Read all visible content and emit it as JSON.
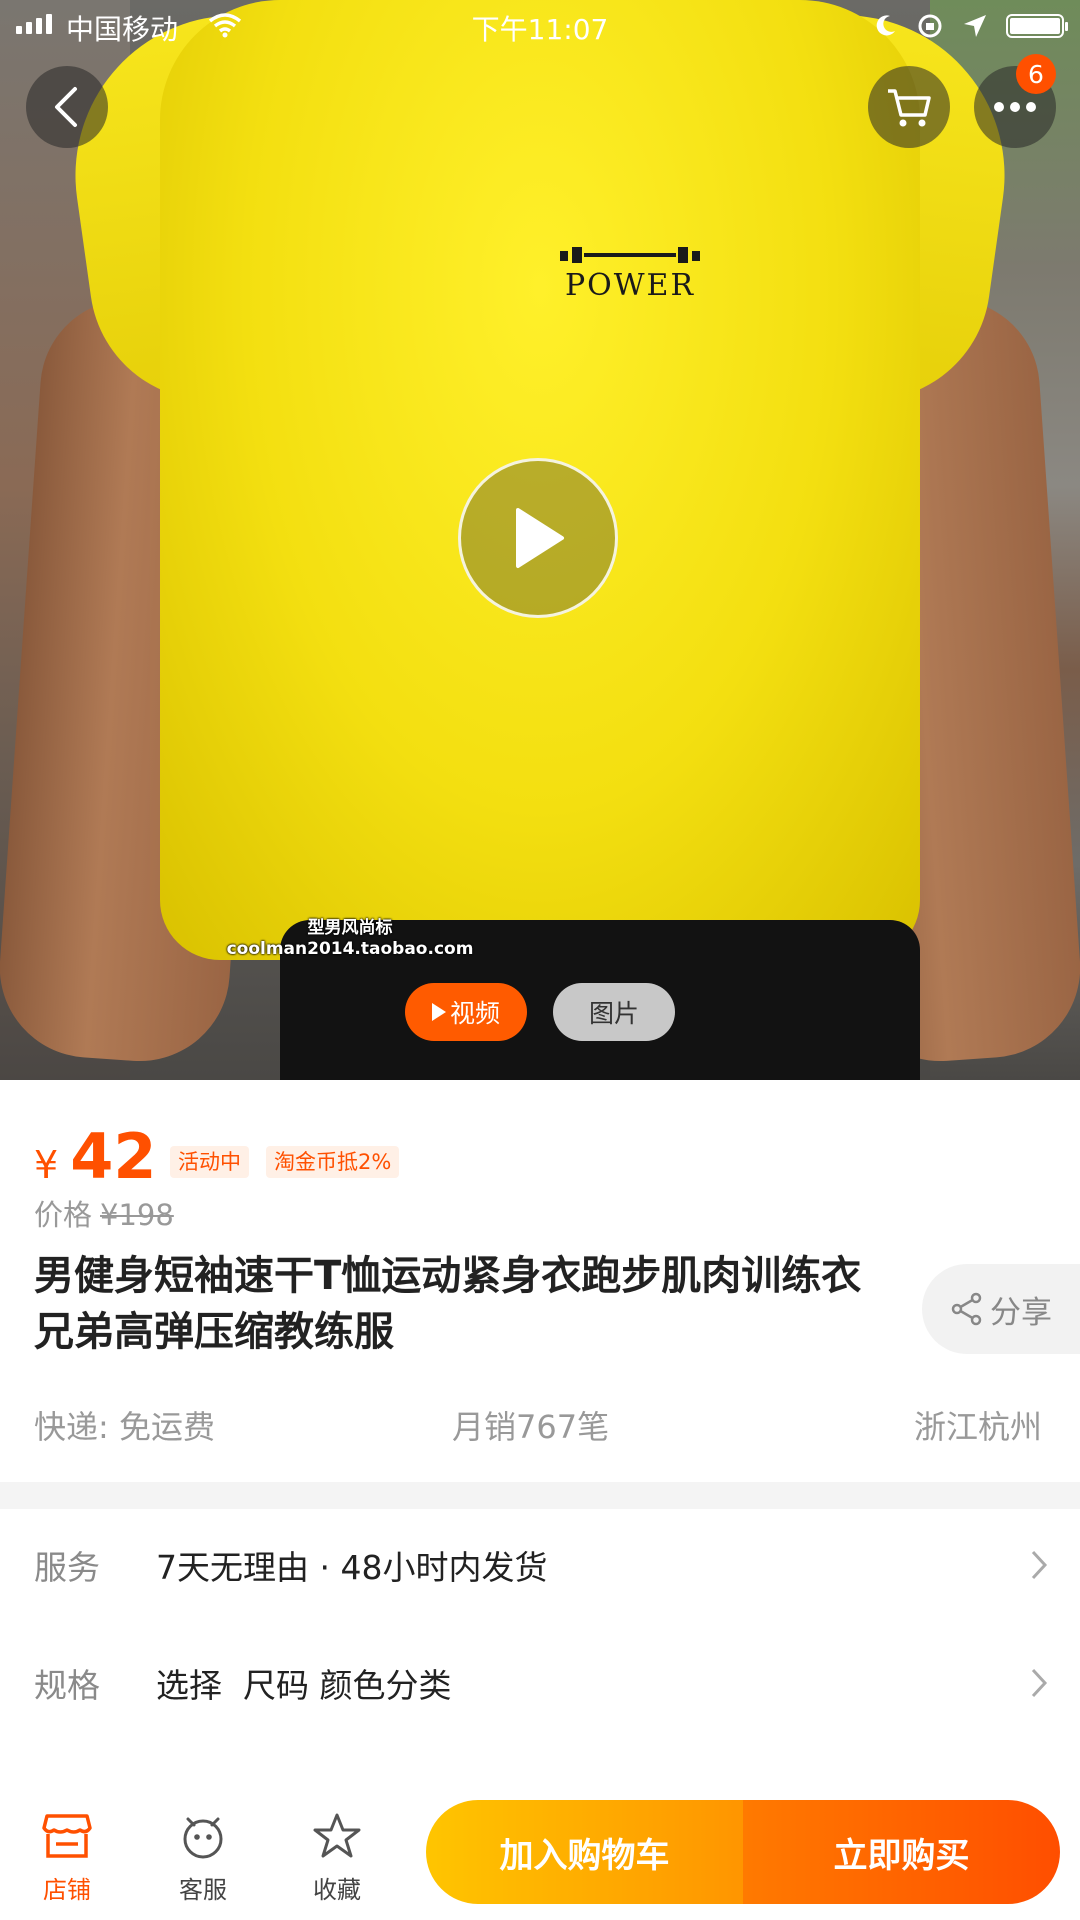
{
  "status_bar": {
    "carrier": "中国移动",
    "time": "下午11:07",
    "battery_level": 1.0
  },
  "hero": {
    "logo_text": "POWER",
    "watermark_line1": "型男风尚标",
    "watermark_line2": "coolman2014.taobao.com",
    "cart_badge": "6",
    "tab_video": "视频",
    "tab_photo": "图片"
  },
  "product": {
    "currency": "¥",
    "price": "42",
    "tag_activity": "活动中",
    "tag_coin": "淘金币抵2%",
    "orig_label": "价格",
    "orig_price": "¥198",
    "title": "男健身短袖速干T恤运动紧身衣跑步肌肉训练衣兄弟高弹压缩教练服",
    "share_label": "分享",
    "shipping": "快递: 免运费",
    "monthly_sales": "月销767笔",
    "location": "浙江杭州"
  },
  "rows": {
    "service_label": "服务",
    "service_value": "7天无理由 · 48小时内发货",
    "spec_label": "规格",
    "spec_value": "选择  尺码 颜色分类"
  },
  "bottom_bar": {
    "store": "店铺",
    "service": "客服",
    "favorite": "收藏",
    "add_to_cart": "加入购物车",
    "buy_now": "立即购买"
  },
  "colors": {
    "accent": "#ff5000",
    "cart_gradient": [
      "#ffc500",
      "#ff9500"
    ],
    "buy_gradient": [
      "#ff7a00",
      "#ff4e00"
    ]
  },
  "icons": [
    "back-icon",
    "cart-icon",
    "more-icon",
    "play-icon",
    "share-icon",
    "chevron-right-icon",
    "store-icon",
    "service-icon",
    "star-icon",
    "wifi-icon"
  ]
}
